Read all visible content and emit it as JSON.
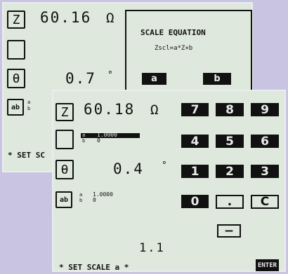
{
  "back": {
    "z_label": "Z",
    "z_value": "60.16",
    "z_unit": "Ω",
    "theta_label": "θ",
    "theta_value": "0.7",
    "theta_unit": "°",
    "ab_label": "ab",
    "ab_sub_a": "a",
    "ab_sub_b": "b",
    "status": "* SET SC",
    "scale_title": "SCALE EQUATION",
    "scale_formula": "Zscl=a*Z+b",
    "btn_a": "a",
    "btn_b": "b"
  },
  "front": {
    "z_label": "Z",
    "z_value": "60.18",
    "z_unit": "Ω",
    "row2_a": "a",
    "row2_b": "b",
    "row2_val": "1.0000",
    "row2_val2": "0",
    "theta_label": "θ",
    "theta_value": "0.4",
    "theta_unit": "°",
    "ab_label": "ab",
    "ab_sub_a": "a",
    "ab_sub_b": "b",
    "ab_val": "1.0000",
    "ab_val2": "0",
    "entry": "1.1",
    "status": "* SET SCALE a *",
    "enter": "ENTER",
    "keys": [
      "7",
      "8",
      "9",
      "4",
      "5",
      "6",
      "1",
      "2",
      "3",
      "0",
      ".",
      "C",
      "−"
    ]
  }
}
